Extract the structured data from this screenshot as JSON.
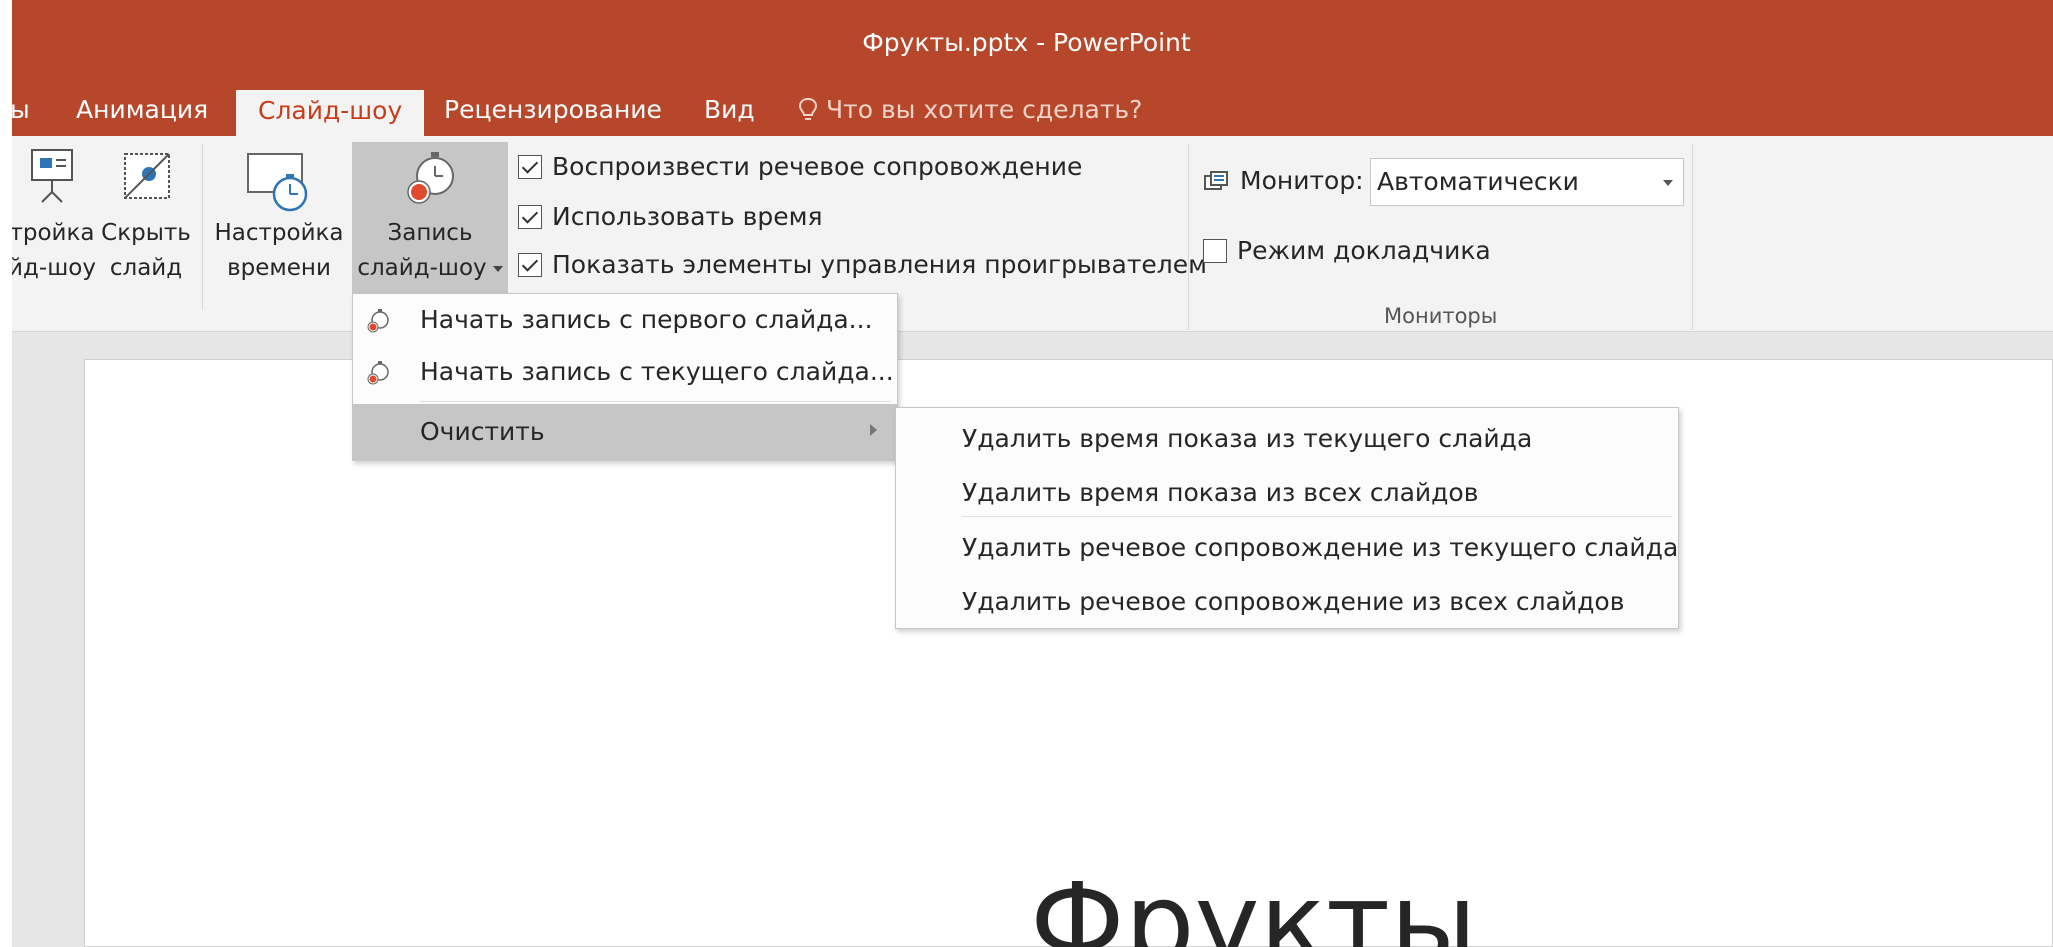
{
  "window": {
    "title": "Фрукты.pptx - PowerPoint"
  },
  "tabs": [
    {
      "label": "ы"
    },
    {
      "label": "Анимация"
    },
    {
      "label": "Слайд-шоу"
    },
    {
      "label": "Рецензирование"
    },
    {
      "label": "Вид"
    }
  ],
  "tell_me": {
    "placeholder": "Что вы хотите сделать?"
  },
  "ribbon": {
    "setup_show": {
      "line1": "тройка",
      "line2": "йд-шоу"
    },
    "hide_slide": {
      "line1": "Скрыть",
      "line2": "слайд"
    },
    "rehearse": {
      "line1": "Настройка",
      "line2": "времени"
    },
    "record": {
      "line1": "Запись",
      "line2": "слайд-шоу"
    },
    "checkboxes": [
      {
        "label": "Воспроизвести речевое сопровождение",
        "checked": true
      },
      {
        "label": "Использовать время",
        "checked": true
      },
      {
        "label": "Показать элементы управления проигрывателем",
        "checked": true
      }
    ],
    "monitor_label": "Монитор:",
    "monitor_value": "Автоматически",
    "presenter_view": {
      "label": "Режим докладчика",
      "checked": false
    },
    "monitors_group_label": "Мониторы"
  },
  "record_menu": {
    "items": [
      {
        "label": "Начать запись с первого слайда..."
      },
      {
        "label": "Начать запись с текущего слайда..."
      },
      {
        "label": "Очистить"
      }
    ]
  },
  "clear_submenu": {
    "items": [
      {
        "label": "Удалить время показа из текущего слайда"
      },
      {
        "label": "Удалить время показа из всех слайдов"
      },
      {
        "label": "Удалить речевое сопровождение из текущего слайда"
      },
      {
        "label": "Удалить речевое сопровождение из всех слайдов"
      }
    ]
  },
  "slide": {
    "title": "Фрукты"
  },
  "colors": {
    "accent": "#b7472a",
    "active_tab_text": "#c43e1c",
    "ribbon_bg": "#f3f3f3",
    "highlight": "#c6c6c6"
  }
}
